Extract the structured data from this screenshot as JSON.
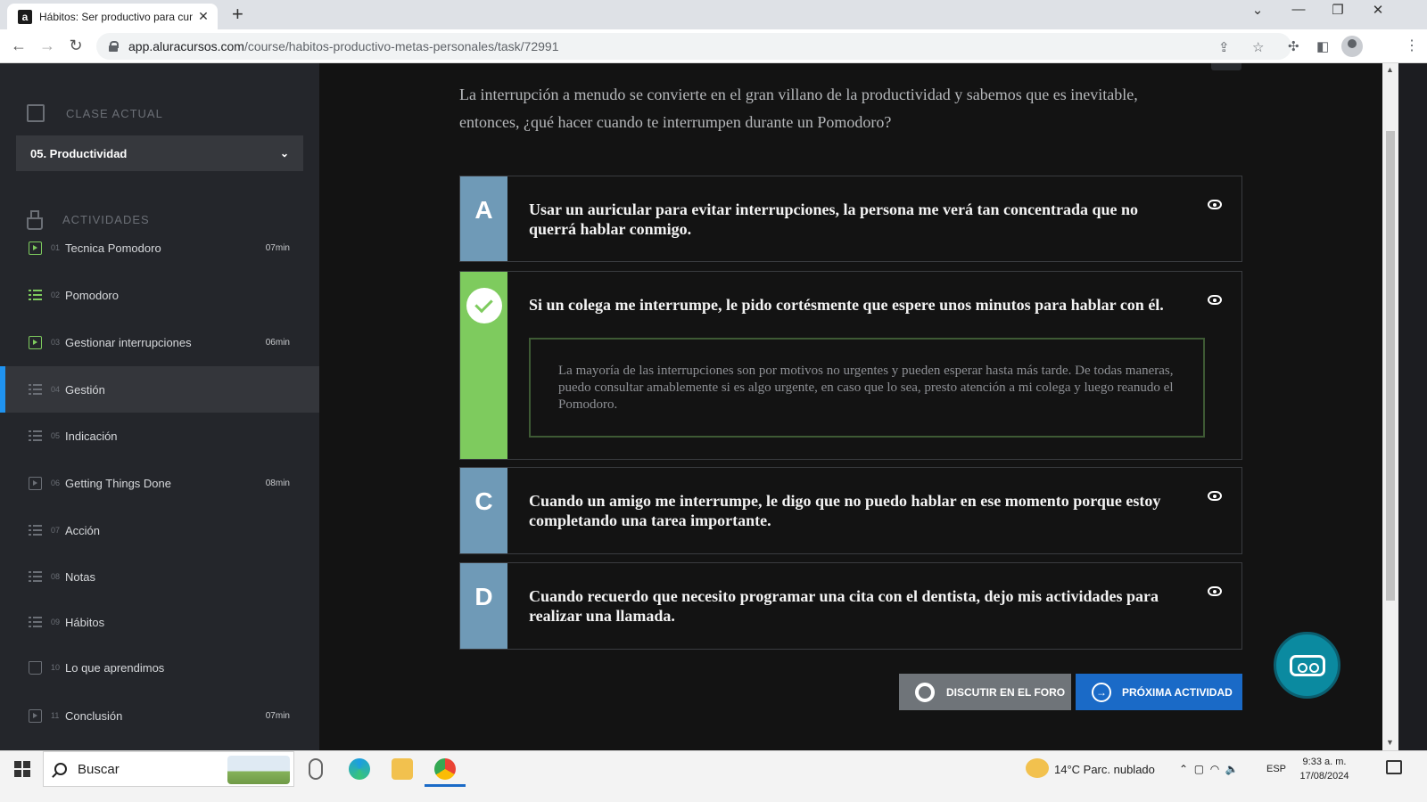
{
  "browser": {
    "tab_title": "Hábitos: Ser productivo para cumplir metas personales",
    "favicon_letter": "a",
    "url_host": "app.aluracursos.com",
    "url_path": "/course/habitos-productivo-metas-personales/task/72991"
  },
  "sidebar": {
    "current_class_label": "CLASE ACTUAL",
    "current_class_value": "05. Productividad",
    "activities_label": "ACTIVIDADES",
    "items": [
      {
        "num": "01",
        "label": "Tecnica Pomodoro",
        "duration": "07min",
        "icon": "video-icon",
        "done": true
      },
      {
        "num": "02",
        "label": "Pomodoro",
        "duration": "",
        "icon": "list-icon",
        "done": true
      },
      {
        "num": "03",
        "label": "Gestionar interrupciones",
        "duration": "06min",
        "icon": "video-icon",
        "done": true
      },
      {
        "num": "04",
        "label": "Gestión",
        "duration": "",
        "icon": "list-icon",
        "done": false,
        "active": true
      },
      {
        "num": "05",
        "label": "Indicación",
        "duration": "",
        "icon": "list-icon",
        "done": false
      },
      {
        "num": "06",
        "label": "Getting Things Done",
        "duration": "08min",
        "icon": "video-icon",
        "done": false
      },
      {
        "num": "07",
        "label": "Acción",
        "duration": "",
        "icon": "list-icon",
        "done": false
      },
      {
        "num": "08",
        "label": "Notas",
        "duration": "",
        "icon": "list-icon",
        "done": false
      },
      {
        "num": "09",
        "label": "Hábitos",
        "duration": "",
        "icon": "list-icon",
        "done": false
      },
      {
        "num": "10",
        "label": "Lo que aprendimos",
        "duration": "",
        "icon": "book-icon",
        "done": false
      },
      {
        "num": "11",
        "label": "Conclusión",
        "duration": "07min",
        "icon": "video-icon",
        "done": false
      }
    ]
  },
  "main": {
    "question": "La interrupción a menudo se convierte en el gran villano de la productividad y sabemos que es inevitable, entonces, ¿qué hacer cuando te interrumpen durante un Pomodoro?",
    "options": [
      {
        "letter": "A",
        "text": "Usar un auricular para evitar interrupciones, la persona me verá tan concentrada que no querrá hablar conmigo."
      },
      {
        "letter": "",
        "text": "Si un colega me interrumpe, le pido cortésmente que espere unos minutos para hablar con él.",
        "correct": true,
        "explanation": "La mayoría de las interrupciones son por motivos no urgentes y pueden esperar hasta más tarde. De todas maneras, puedo consultar amablemente si es algo urgente, en caso que lo sea, presto atención a mi colega y luego reanudo el Pomodoro."
      },
      {
        "letter": "C",
        "text": "Cuando un amigo me interrumpe, le digo que no puedo hablar en ese momento porque estoy completando una tarea importante."
      },
      {
        "letter": "D",
        "text": "Cuando recuerdo que necesito programar una cita con el dentista, dejo mis actividades para realizar una llamada."
      }
    ],
    "forum_button": "DISCUTIR EN EL FORO",
    "next_button": "PRÓXIMA ACTIVIDAD"
  },
  "taskbar": {
    "search_placeholder": "Buscar",
    "weather": "14°C  Parc. nublado",
    "language": "ESP",
    "time": "9:33 a. m.",
    "date": "17/08/2024"
  },
  "colors": {
    "accent_blue": "#1a6ac7",
    "correct_green": "#7ecb5e",
    "option_blue": "#6f9ab7",
    "active_border": "#1f93f0"
  }
}
